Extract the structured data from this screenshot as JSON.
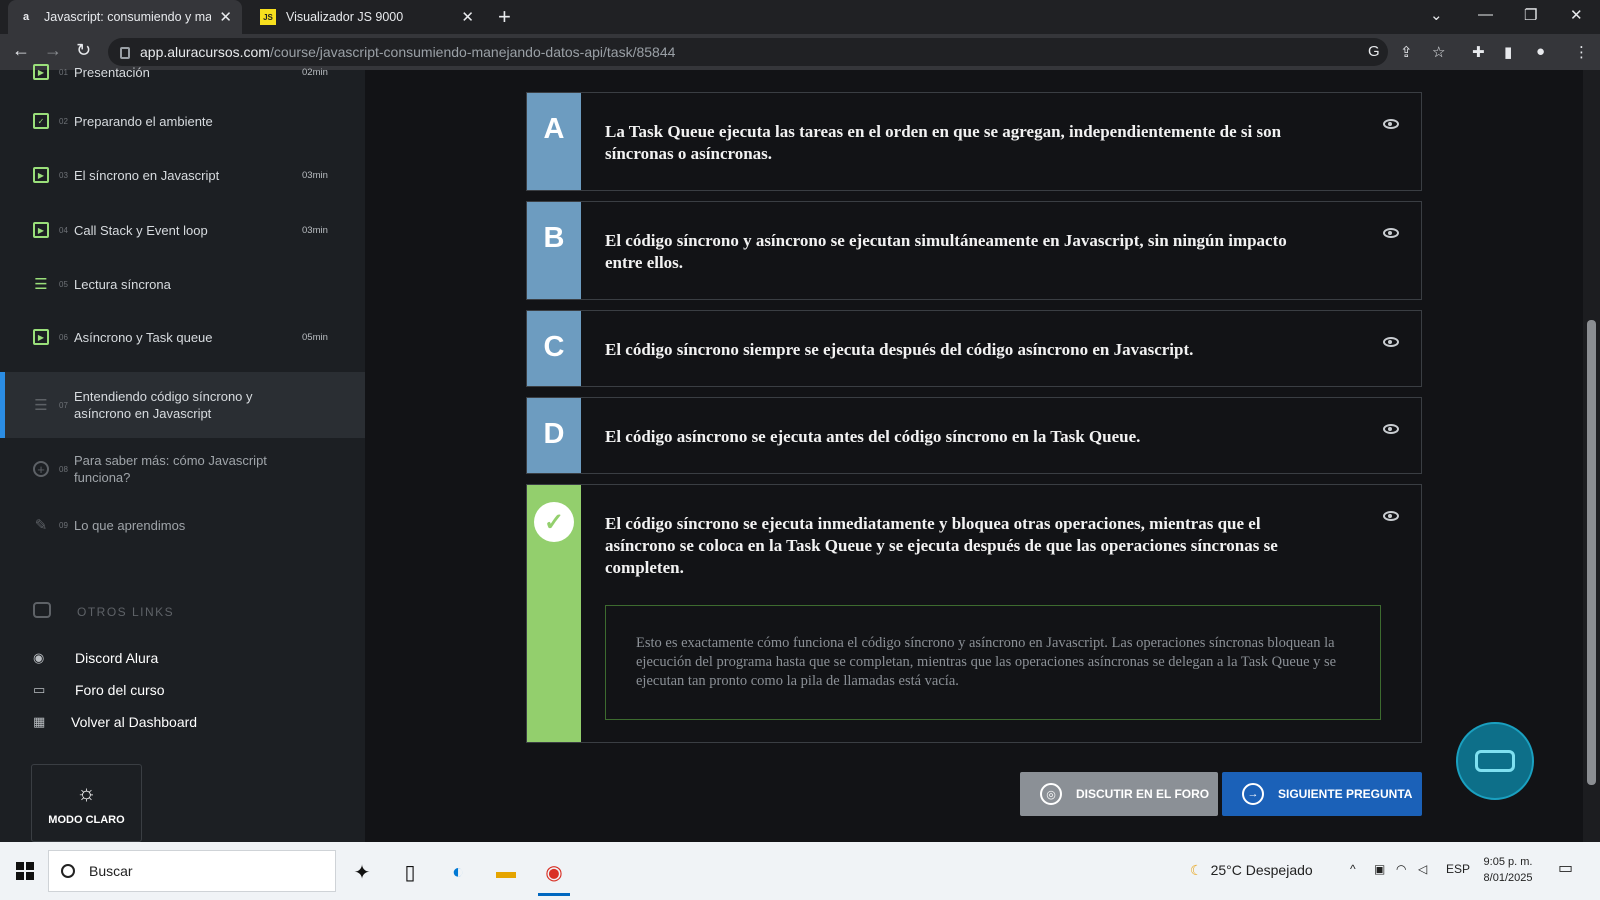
{
  "browser": {
    "tabs": [
      {
        "favicon": "a",
        "title": "Javascript: consumiendo y manej",
        "active": true
      },
      {
        "favicon": "JS",
        "title": "Visualizador JS 9000",
        "active": false
      }
    ],
    "url_host": "app.aluracursos.com",
    "url_path": "/course/javascript-consumiendo-manejando-datos-api/task/85844"
  },
  "sidebar": {
    "lessons": [
      {
        "num": "01",
        "name": "Presentación",
        "duration": "02min",
        "icon": "video-icon"
      },
      {
        "num": "02",
        "name": "Preparando el ambiente",
        "duration": "",
        "icon": "clipboard-check-icon"
      },
      {
        "num": "03",
        "name": "El síncrono en Javascript",
        "duration": "03min",
        "icon": "video-icon"
      },
      {
        "num": "04",
        "name": "Call Stack y Event loop",
        "duration": "03min",
        "icon": "video-icon"
      },
      {
        "num": "05",
        "name": "Lectura síncrona",
        "duration": "",
        "icon": "list-icon"
      },
      {
        "num": "06",
        "name": "Asíncrono y Task queue",
        "duration": "05min",
        "icon": "video-icon"
      },
      {
        "num": "07",
        "name": "Entendiendo código síncrono y asíncrono en Javascript",
        "duration": "",
        "icon": "list-icon"
      },
      {
        "num": "08",
        "name": "Para saber más: cómo Javascript funciona?",
        "duration": "",
        "icon": "plus-circle-icon"
      },
      {
        "num": "09",
        "name": "Lo que aprendimos",
        "duration": "",
        "icon": "user-edit-icon"
      }
    ],
    "otros_label": "OTROS LINKS",
    "links": [
      {
        "label": "Discord Alura",
        "icon": "discord-icon"
      },
      {
        "label": "Foro del curso",
        "icon": "chat-icon"
      },
      {
        "label": "Volver al Dashboard",
        "icon": "dashboard-icon"
      }
    ],
    "modo_label": "MODO CLARO"
  },
  "answers": [
    {
      "letter": "A",
      "text": "La Task Queue ejecuta las tareas en el orden en que se agregan, independientemente de si son síncronas o asíncronas."
    },
    {
      "letter": "B",
      "text": "El código síncrono y asíncrono se ejecutan simultáneamente en Javascript, sin ningún impacto entre ellos."
    },
    {
      "letter": "C",
      "text": "El código síncrono siempre se ejecuta después del código asíncrono en Javascript."
    },
    {
      "letter": "D",
      "text": "El código asíncrono se ejecuta antes del código síncrono en la Task Queue."
    },
    {
      "letter": "",
      "text": "El código síncrono se ejecuta inmediatamente y bloquea otras operaciones, mientras que el asíncrono se coloca en la Task Queue y se ejecuta después de que las operaciones síncronas se completen.",
      "correct": true,
      "explanation": "Esto es exactamente cómo funciona el código síncrono y asíncrono en Javascript. Las operaciones síncronas bloquean la ejecución del programa hasta que se completan, mientras que las operaciones asíncronas se delegan a la Task Queue y se ejecutan tan pronto como la pila de llamadas está vacía."
    }
  ],
  "buttons": {
    "foro": "DISCUTIR EN EL FORO",
    "siguiente": "SIGUIENTE PREGUNTA"
  },
  "taskbar": {
    "search_placeholder": "Buscar",
    "weather": "25°C  Despejado",
    "lang": "ESP",
    "time": "9:05 p. m.",
    "date": "8/01/2025"
  },
  "colors": {
    "letter_bg": "#6d9cc0",
    "correct_bg": "#93cf6d",
    "accent_blue": "#1b61b8"
  }
}
